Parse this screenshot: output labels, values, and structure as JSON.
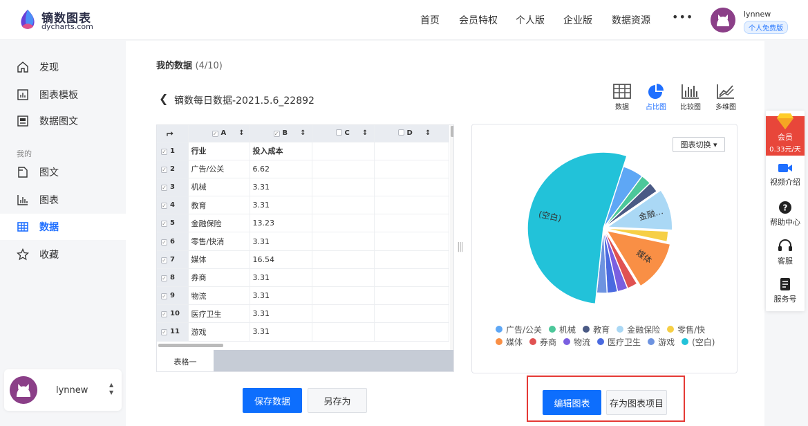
{
  "brand": {
    "name": "镝数图表",
    "domain": "dycharts.com"
  },
  "nav": [
    "首页",
    "会员特权",
    "个人版",
    "企业版",
    "数据资源"
  ],
  "nav_more": "•••",
  "user": {
    "name": "lynnew",
    "badge": "个人免费版"
  },
  "sidebar": {
    "items_top": [
      {
        "label": "发现",
        "icon": "home-icon"
      },
      {
        "label": "图表模板",
        "icon": "chart-template-icon"
      },
      {
        "label": "数据图文",
        "icon": "data-article-icon"
      }
    ],
    "group_label": "我的",
    "items_mine": [
      {
        "label": "图文",
        "icon": "document-icon"
      },
      {
        "label": "图表",
        "icon": "bar-chart-icon"
      },
      {
        "label": "数据",
        "icon": "table-icon",
        "active": true
      },
      {
        "label": "收藏",
        "icon": "star-icon"
      }
    ],
    "user_card_name": "lynnew"
  },
  "main": {
    "title": "我的数据",
    "count": "(4/10)",
    "dataset_name": "镝数每日数据-2021.5.6_22892",
    "views": [
      {
        "label": "数据",
        "icon": "table-view-icon"
      },
      {
        "label": "占比图",
        "icon": "pie-view-icon",
        "active": true
      },
      {
        "label": "比较图",
        "icon": "compare-view-icon"
      },
      {
        "label": "多维图",
        "icon": "multi-view-icon"
      }
    ]
  },
  "table": {
    "columns": [
      "A",
      "B",
      "C",
      "D"
    ],
    "rows": [
      {
        "n": "1",
        "a": "行业",
        "b": "投入成本"
      },
      {
        "n": "2",
        "a": "广告/公关",
        "b": "6.62"
      },
      {
        "n": "3",
        "a": "机械",
        "b": "3.31"
      },
      {
        "n": "4",
        "a": "教育",
        "b": "3.31"
      },
      {
        "n": "5",
        "a": "金融保险",
        "b": "13.23"
      },
      {
        "n": "6",
        "a": "零售/快消",
        "b": "3.31"
      },
      {
        "n": "7",
        "a": "媒体",
        "b": "16.54"
      },
      {
        "n": "8",
        "a": "券商",
        "b": "3.31"
      },
      {
        "n": "9",
        "a": "物流",
        "b": "3.31"
      },
      {
        "n": "10",
        "a": "医疗卫生",
        "b": "3.31"
      },
      {
        "n": "11",
        "a": "游戏",
        "b": "3.31"
      }
    ],
    "sheet_tab": "表格一"
  },
  "chart_panel": {
    "switch_label": "图表切换"
  },
  "chart_data": {
    "type": "pie",
    "labels": [
      "广告/公关",
      "机械",
      "教育",
      "金融保险",
      "零售/快消",
      "媒体",
      "券商",
      "物流",
      "医疗卫生",
      "游戏",
      "(空白)"
    ],
    "values": [
      6.62,
      3.31,
      3.31,
      13.23,
      3.31,
      16.54,
      3.31,
      3.31,
      3.31,
      3.31,
      68.02
    ],
    "colors": [
      "#5ea7f5",
      "#4cc79a",
      "#4a5a85",
      "#aad8f5",
      "#f6cf45",
      "#f98f45",
      "#e05252",
      "#7a5fe0",
      "#4a6ae0",
      "#6d93e0",
      "#22c2d9"
    ],
    "slice_labels": [
      "",
      "",
      "",
      "金融…",
      "",
      "媒体",
      "",
      "",
      "",
      "",
      "(空白)"
    ],
    "legend_labels": [
      "广告/公关",
      "机械",
      "教育",
      "金融保险",
      "零售/快",
      "媒体",
      "券商",
      "物流",
      "医疗卫生",
      "游戏",
      "(空白)"
    ],
    "legend_placement": "bottom"
  },
  "buttons": {
    "save": "保存数据",
    "save_as": "另存为",
    "edit_chart": "编辑图表",
    "save_project": "存为图表项目"
  },
  "float_bar": {
    "member_title": "会员",
    "member_price": "0.33元/天",
    "items": [
      {
        "label": "视频介绍",
        "icon": "video-icon"
      },
      {
        "label": "帮助中心",
        "icon": "help-icon"
      },
      {
        "label": "客服",
        "icon": "headset-icon"
      },
      {
        "label": "服务号",
        "icon": "service-account-icon"
      }
    ]
  }
}
